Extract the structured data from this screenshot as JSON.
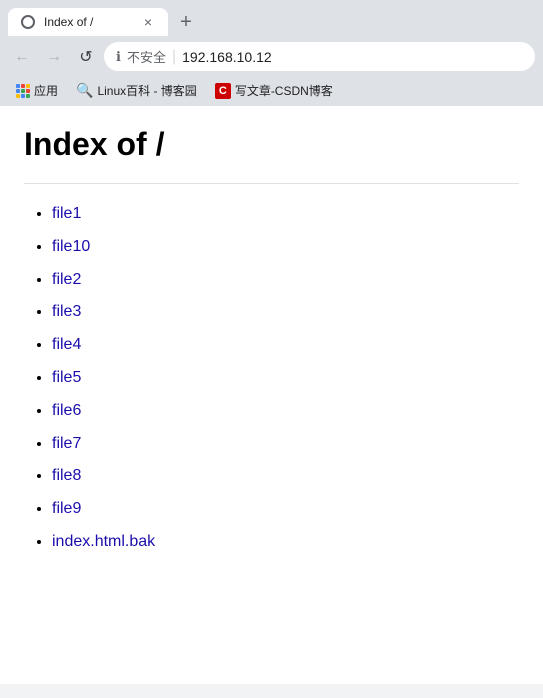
{
  "browser": {
    "tab": {
      "title": "Index of /",
      "close_label": "×",
      "new_tab_label": "+"
    },
    "nav": {
      "back_label": "←",
      "forward_label": "→",
      "refresh_label": "↺"
    },
    "address": {
      "security_label": "不安全",
      "divider": "|",
      "url": "192.168.10.12"
    },
    "bookmarks": [
      {
        "icon_type": "apps",
        "label": "应用"
      },
      {
        "icon_type": "linux",
        "label": "Linux百科 - 博客园"
      },
      {
        "icon_type": "csdn",
        "label": "写文章-CSDN博客"
      }
    ]
  },
  "page": {
    "heading": "Index of /",
    "files": [
      {
        "name": "file1",
        "href": "file1"
      },
      {
        "name": "file10",
        "href": "file10"
      },
      {
        "name": "file2",
        "href": "file2"
      },
      {
        "name": "file3",
        "href": "file3"
      },
      {
        "name": "file4",
        "href": "file4"
      },
      {
        "name": "file5",
        "href": "file5"
      },
      {
        "name": "file6",
        "href": "file6"
      },
      {
        "name": "file7",
        "href": "file7"
      },
      {
        "name": "file8",
        "href": "file8"
      },
      {
        "name": "file9",
        "href": "file9"
      },
      {
        "name": "index.html.bak",
        "href": "index.html.bak"
      }
    ]
  }
}
